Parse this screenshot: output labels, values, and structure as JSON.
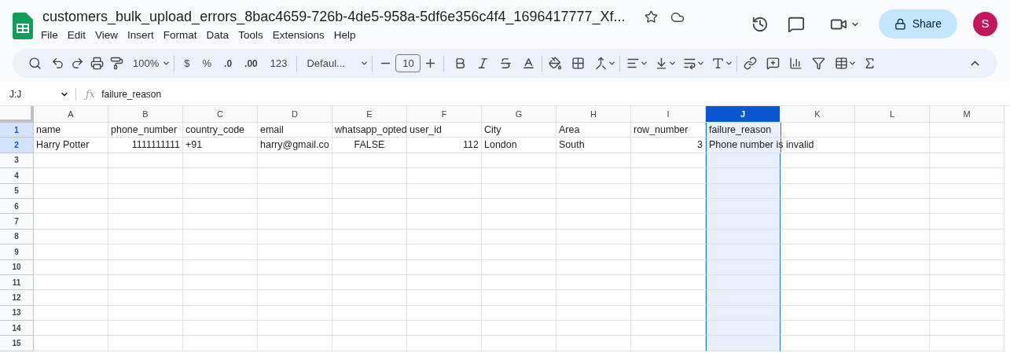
{
  "document": {
    "title": "customers_bulk_upload_errors_8bac4659-726b-4de5-958a-5df6e356c4f4_1696417777_Xf...",
    "starred": false
  },
  "menu": [
    "File",
    "Edit",
    "View",
    "Insert",
    "Format",
    "Data",
    "Tools",
    "Extensions",
    "Help"
  ],
  "share_button": "Share",
  "avatar": "S",
  "toolbar": {
    "zoom": "100%",
    "currency": "$",
    "percent": "%",
    "number_format": "123",
    "font": "Defaul...",
    "font_size": "10",
    "decrease_decimal": ".0",
    "increase_decimal": ".00"
  },
  "fx": "ƒx",
  "name_box": "J:J",
  "formula": "failure_reason",
  "grid": {
    "columns": [
      {
        "label": "A",
        "selected": false
      },
      {
        "label": "B",
        "selected": false
      },
      {
        "label": "C",
        "selected": false
      },
      {
        "label": "D",
        "selected": false
      },
      {
        "label": "E",
        "selected": false
      },
      {
        "label": "F",
        "selected": false
      },
      {
        "label": "G",
        "selected": false
      },
      {
        "label": "H",
        "selected": false
      },
      {
        "label": "I",
        "selected": false
      },
      {
        "label": "J",
        "selected": true
      },
      {
        "label": "K",
        "selected": false
      },
      {
        "label": "L",
        "selected": false
      },
      {
        "label": "M",
        "selected": false
      }
    ],
    "rows": [
      {
        "number": "1",
        "cells": [
          {
            "text": "name",
            "kind": "text"
          },
          {
            "text": "phone_number",
            "kind": "text"
          },
          {
            "text": "country_code",
            "kind": "text"
          },
          {
            "text": "email",
            "kind": "text"
          },
          {
            "text": "whatsapp_opted",
            "kind": "text"
          },
          {
            "text": "user_id",
            "kind": "text"
          },
          {
            "text": "City",
            "kind": "text"
          },
          {
            "text": "Area",
            "kind": "text"
          },
          {
            "text": "row_number",
            "kind": "text"
          },
          {
            "text": "failure_reason",
            "kind": "text"
          }
        ]
      },
      {
        "number": "2",
        "cells": [
          {
            "text": "Harry Potter",
            "kind": "text"
          },
          {
            "text": "1111111111",
            "kind": "number"
          },
          {
            "text": "+91",
            "kind": "text"
          },
          {
            "text": "harry@gmail.co",
            "kind": "text"
          },
          {
            "text": "FALSE",
            "kind": "boolean"
          },
          {
            "text": "112",
            "kind": "number"
          },
          {
            "text": "London",
            "kind": "text"
          },
          {
            "text": "South",
            "kind": "text"
          },
          {
            "text": "3",
            "kind": "number"
          },
          {
            "text": "Phone number is invalid",
            "kind": "text"
          }
        ]
      },
      {
        "number": "3",
        "cells": []
      },
      {
        "number": "4",
        "cells": []
      },
      {
        "number": "5",
        "cells": []
      },
      {
        "number": "6",
        "cells": []
      },
      {
        "number": "7",
        "cells": []
      },
      {
        "number": "8",
        "cells": []
      },
      {
        "number": "9",
        "cells": []
      },
      {
        "number": "10",
        "cells": []
      },
      {
        "number": "11",
        "cells": []
      },
      {
        "number": "12",
        "cells": []
      },
      {
        "number": "13",
        "cells": []
      },
      {
        "number": "14",
        "cells": []
      },
      {
        "number": "15",
        "cells": []
      }
    ]
  }
}
